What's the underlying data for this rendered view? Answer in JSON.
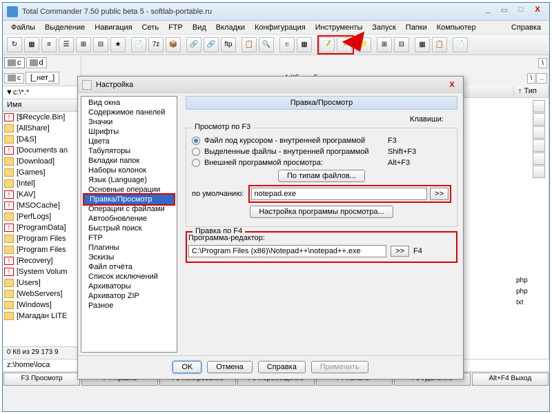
{
  "window": {
    "title": "Total Commander 7.50 public beta 5 - softlab-portable.ru"
  },
  "menu": [
    "Файлы",
    "Выделение",
    "Навигация",
    "Сеть",
    "FTP",
    "Вид",
    "Вкладки",
    "Конфигурация",
    "Инструменты",
    "Запуск",
    "Папки",
    "Компьютер"
  ],
  "menu_help": "Справка",
  "left": {
    "drives": [
      "c",
      "d"
    ],
    "tab": "[_нет_]",
    "path": "c:\\*.*",
    "name_col": "Имя",
    "files": [
      {
        "i": "bang",
        "n": "[$Recycle.Bin]"
      },
      {
        "i": "fold",
        "n": "[AllShare]"
      },
      {
        "i": "fold",
        "n": "[D&S]"
      },
      {
        "i": "bang",
        "n": "[Documents an"
      },
      {
        "i": "fold",
        "n": "[Download]"
      },
      {
        "i": "fold",
        "n": "[Games]"
      },
      {
        "i": "fold",
        "n": "[Intel]"
      },
      {
        "i": "bang",
        "n": "[KAV]"
      },
      {
        "i": "bang",
        "n": "[MSOCache]"
      },
      {
        "i": "fold",
        "n": "[PerfLogs]"
      },
      {
        "i": "bang",
        "n": "[ProgramData]"
      },
      {
        "i": "fold",
        "n": "[Program Files"
      },
      {
        "i": "fold",
        "n": "[Program Files"
      },
      {
        "i": "bang",
        "n": "[Recovery]"
      },
      {
        "i": "bang",
        "n": "[System Volum"
      },
      {
        "i": "fold",
        "n": "[Users]"
      },
      {
        "i": "fold",
        "n": "[WebServers]"
      },
      {
        "i": "fold",
        "n": "[Windows]"
      },
      {
        "i": "fold",
        "n": "[Магадан LITE"
      }
    ],
    "status": "0 Кб из 29 173 9"
  },
  "right": {
    "free": "4 Кб свобод",
    "type_col": "↑ Тип",
    "files": [
      {
        "n": "",
        "t": ""
      },
      {
        "n": "",
        "t": ""
      },
      {
        "n": "",
        "t": ""
      },
      {
        "n": "",
        "t": ""
      },
      {
        "n": "",
        "t": ""
      },
      {
        "n": "",
        "t": ""
      },
      {
        "n": "",
        "t": ""
      },
      {
        "n": "",
        "t": ""
      },
      {
        "n": "",
        "t": ""
      },
      {
        "n": "",
        "t": ""
      },
      {
        "n": "",
        "t": ""
      },
      {
        "n": "",
        "t": ""
      },
      {
        "n": "",
        "t": ""
      },
      {
        "n": "",
        "t": ""
      },
      {
        "n": "",
        "t": ""
      },
      {
        "n": "",
        "t": ""
      },
      {
        "n": "",
        "t": "php"
      },
      {
        "n": "",
        "t": "php"
      },
      {
        "n": "",
        "t": "txt"
      }
    ]
  },
  "cmdline": "z:\\home\\loca",
  "fnbar": [
    "F3 Просмотр",
    "F4 Правка",
    "F5 Копирование",
    "F6 Перемещение",
    "F7 Каталог",
    "F8 Удаление",
    "Alt+F4 Выход"
  ],
  "dialog": {
    "title": "Настройка",
    "tree": [
      "Вид окна",
      "Содержимое панелей",
      "Значки",
      "Шрифты",
      "Цвета",
      "Табуляторы",
      "Вкладки папок",
      "Наборы колонок",
      "Язык (Language)",
      "Основные операции",
      "Правка/Просмотр",
      "Операции с файлами",
      "Автообновление",
      "Быстрый поиск",
      "FTP",
      "Плагины",
      "Эскизы",
      "Файл отчёта",
      "Список исключений",
      "Архиваторы",
      "Архиватор ZIP",
      "Разное"
    ],
    "tree_sel": 10,
    "header": "Правка/Просмотр",
    "keys_label": "Клавиши:",
    "grp1": {
      "title": "Просмотр по F3",
      "r1": "Файл под курсором - внутренней программой",
      "k1": "F3",
      "r2": "Выделенные файлы - внутренней программой",
      "k2": "Shift+F3",
      "r3": "Внешней программой просмотра:",
      "k3": "Alt+F3",
      "btn_types": "По типам файлов...",
      "default_label": "по умолчанию:",
      "default_val": "notepad.exe",
      "cfg_btn": "Настройка программы просмотра..."
    },
    "grp2": {
      "title": "Правка по F4",
      "editor_label": "Программа-редактор:",
      "editor_val": "C:\\Program Files (x86)\\Notepad++\\notepad++.exe",
      "key": "F4"
    },
    "ok": "OK",
    "cancel": "Отмена",
    "help": "Справка",
    "apply": "Применить"
  }
}
